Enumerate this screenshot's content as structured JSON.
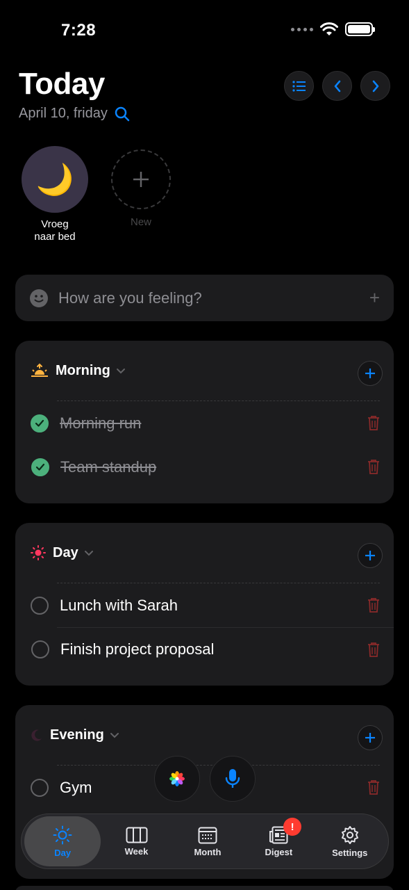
{
  "status": {
    "time": "7:28"
  },
  "header": {
    "title": "Today",
    "date": "April 10, friday"
  },
  "habits": [
    {
      "label": "Vroeg naar bed",
      "emoji": "🌙"
    },
    {
      "label": "New"
    }
  ],
  "mood": {
    "placeholder": "How are you feeling?"
  },
  "sections": {
    "morning": {
      "title": "Morning",
      "tasks": [
        {
          "label": "Morning run",
          "done": true
        },
        {
          "label": "Team standup",
          "done": true
        }
      ]
    },
    "day": {
      "title": "Day",
      "tasks": [
        {
          "label": "Lunch with Sarah",
          "done": false
        },
        {
          "label": "Finish project proposal",
          "done": false
        }
      ]
    },
    "evening": {
      "title": "Evening",
      "tasks": [
        {
          "label": "Gym",
          "done": false
        }
      ]
    }
  },
  "tabbar": {
    "tabs": [
      {
        "label": "Day"
      },
      {
        "label": "Week"
      },
      {
        "label": "Month"
      },
      {
        "label": "Digest",
        "badge": "!"
      },
      {
        "label": "Settings"
      }
    ]
  },
  "colors": {
    "accent": "#0a84ff",
    "done": "#4cb07c",
    "danger": "#8a2a2a",
    "card": "#1c1c1e"
  }
}
